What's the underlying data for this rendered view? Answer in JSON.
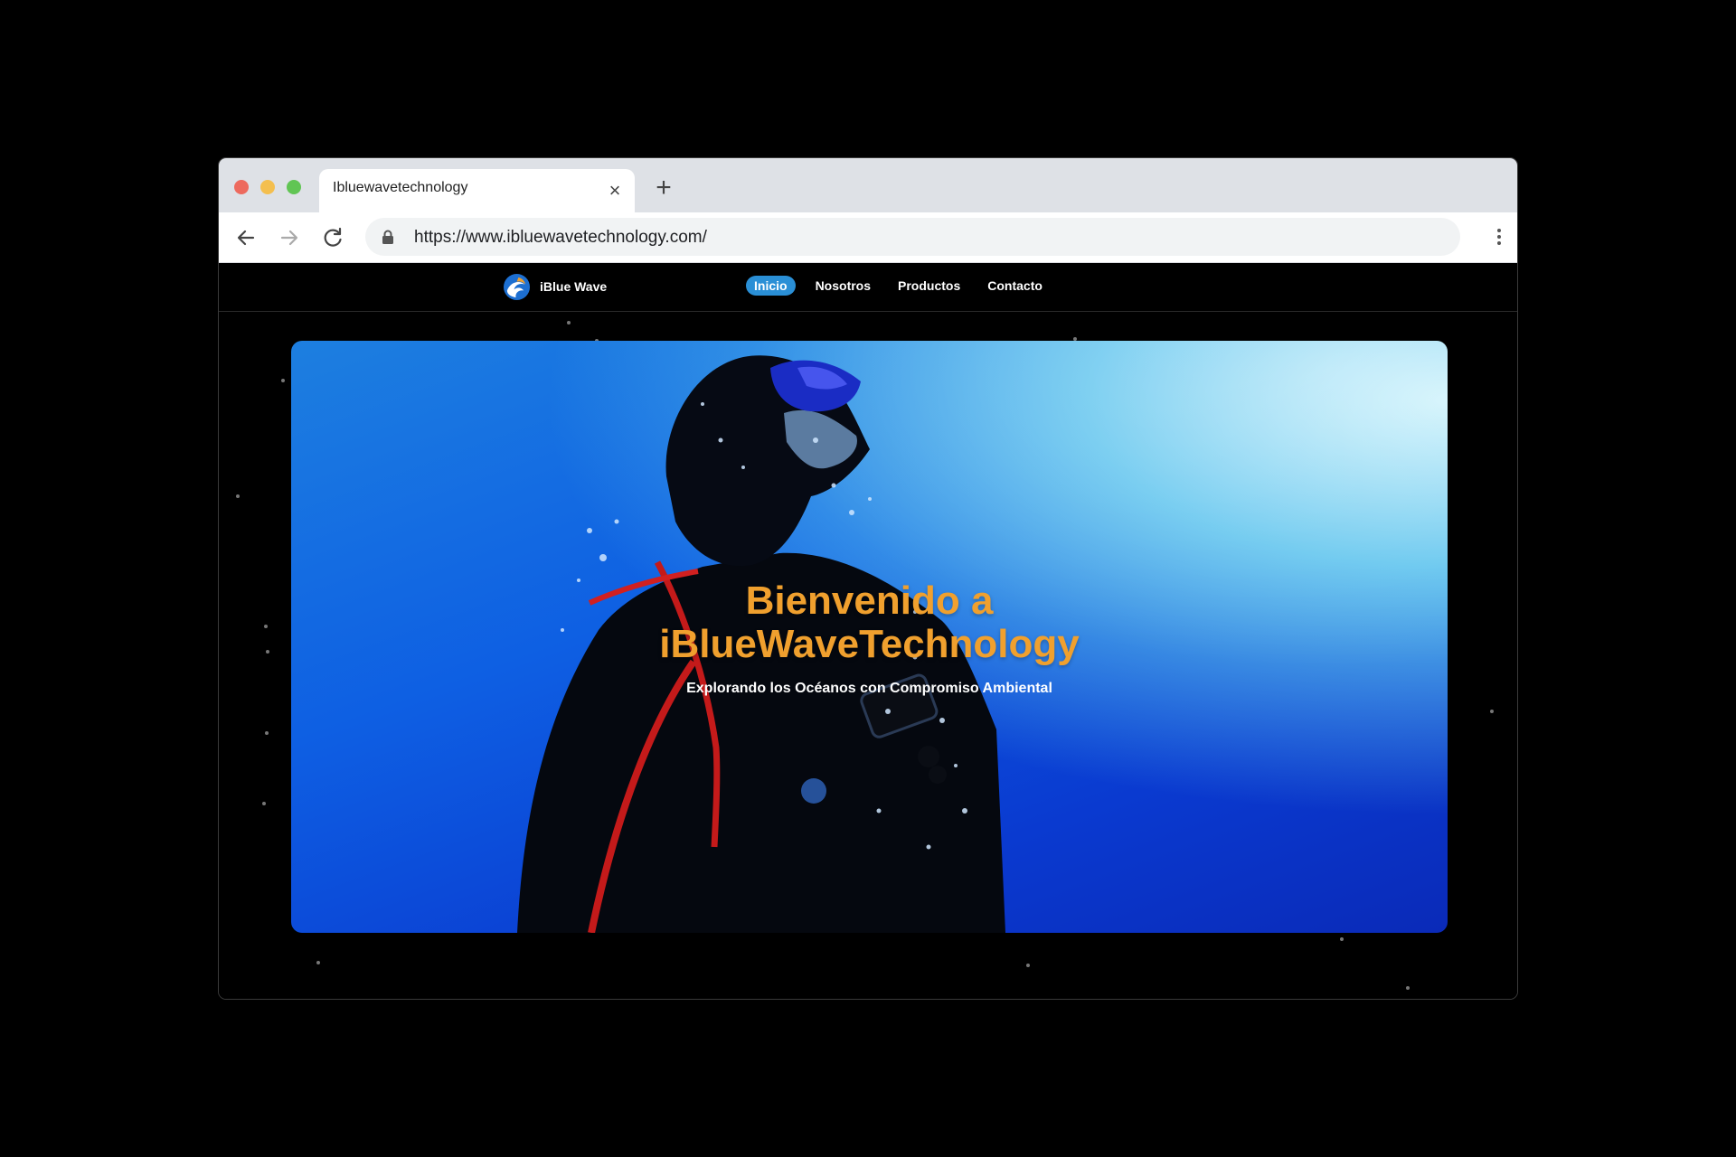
{
  "browser": {
    "tab_title": "Ibluewavetechnology",
    "url": "https://www.ibluewavetechnology.com/"
  },
  "site": {
    "logo_text": "iBlue Wave",
    "nav": [
      {
        "label": "Inicio",
        "active": true
      },
      {
        "label": "Nosotros",
        "active": false
      },
      {
        "label": "Productos",
        "active": false
      },
      {
        "label": "Contacto",
        "active": false
      }
    ]
  },
  "hero": {
    "title_line1": "Bienvenido a",
    "title_line2": "iBlueWaveTechnology",
    "subtitle": "Explorando los Océanos con Compromiso Ambiental"
  },
  "colors": {
    "accent": "#2a8fd6",
    "title": "#f0a02e"
  },
  "icons": [
    "close-icon",
    "plus-icon",
    "back-arrow-icon",
    "forward-arrow-icon",
    "reload-icon",
    "lock-icon",
    "kebab-menu-icon",
    "logo-icon"
  ]
}
